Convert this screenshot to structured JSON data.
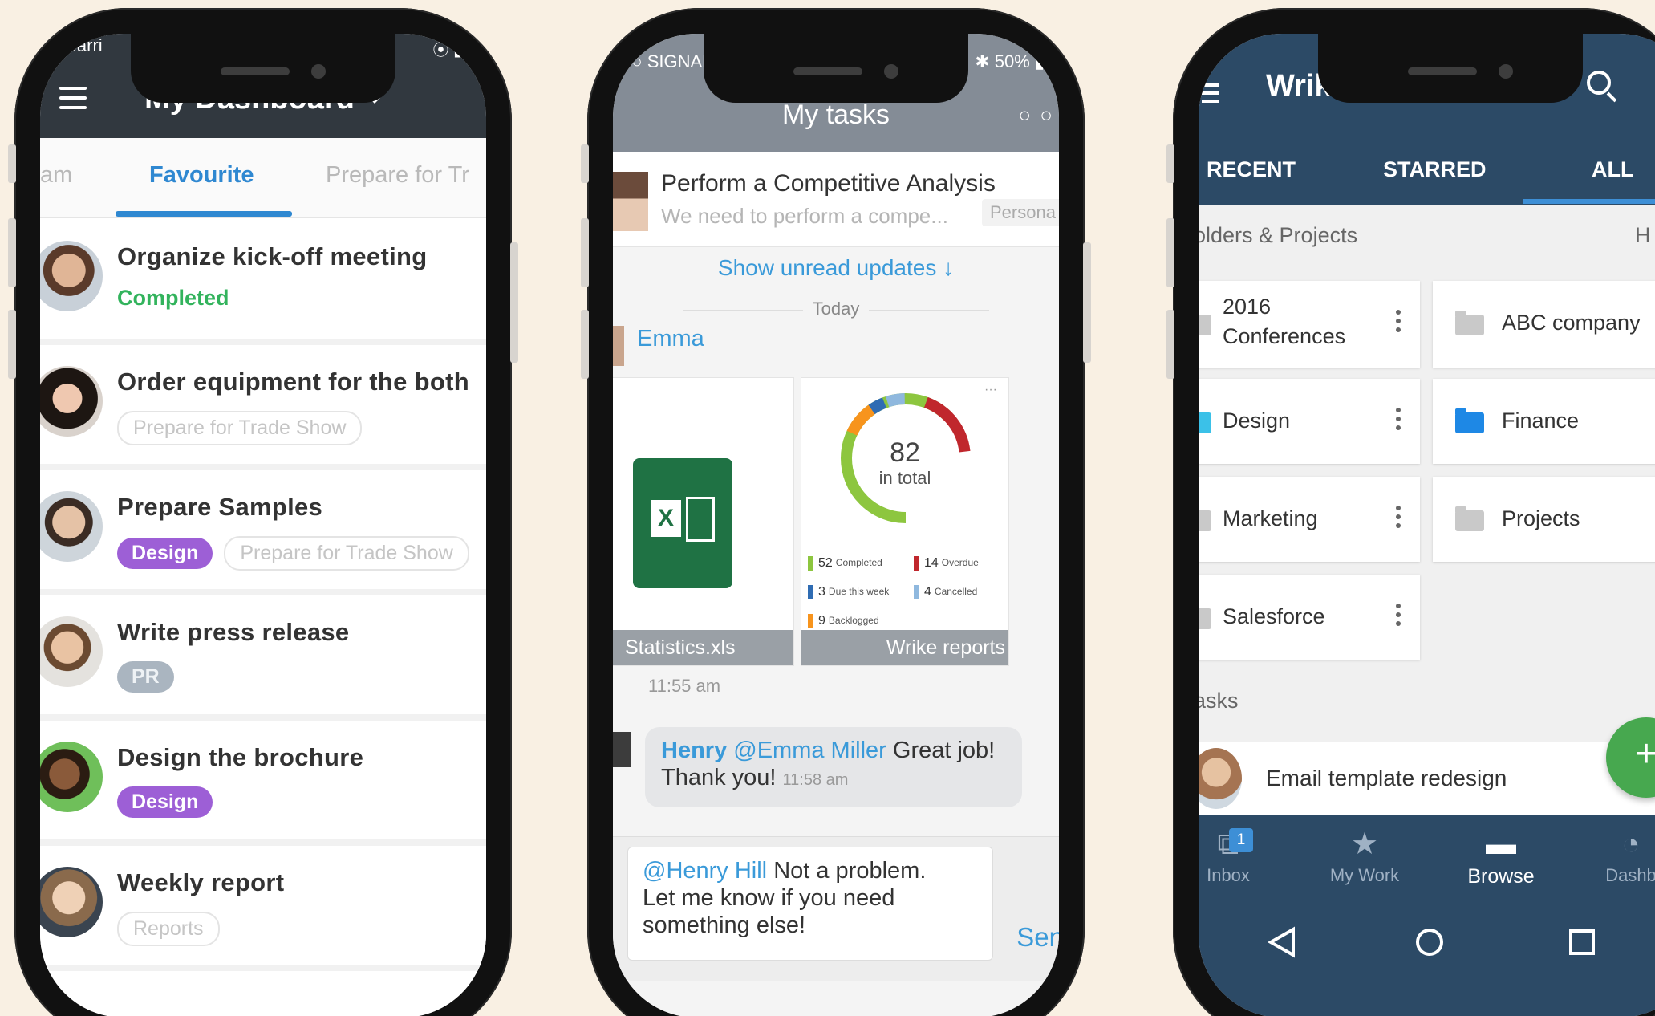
{
  "phone1": {
    "status": {
      "carrier": "Carri",
      "wifi": "⦿ ▮"
    },
    "header": {
      "title": "My Dashboard"
    },
    "tabs": [
      "am",
      "Favourite",
      "Prepare for Tr"
    ],
    "tasks": [
      {
        "title": "Organize kick-off meeting",
        "status": "Completed"
      },
      {
        "title": "Order equipment for the both",
        "tags": [
          "Prepare for Trade Show"
        ]
      },
      {
        "title": "Prepare Samples",
        "tags": [
          "Design",
          "Prepare for Trade Show"
        ]
      },
      {
        "title": "Write press release",
        "tags": [
          "PR"
        ]
      },
      {
        "title": "Design the brochure",
        "tags": [
          "Design"
        ]
      },
      {
        "title": "Weekly report",
        "tags": [
          "Reports"
        ]
      }
    ]
  },
  "phone2": {
    "status": {
      "signal": "●○ SIGNAL",
      "battery": "✱ 50% ▮"
    },
    "header": {
      "title": "My tasks",
      "more": "○ ○"
    },
    "task": {
      "title": "Perform a Competitive Analysis",
      "desc": "We need to perform a compe...",
      "tag": "Persona"
    },
    "unread": "Show unread updates ↓",
    "today": "Today",
    "author": "Emma",
    "attachments": {
      "file": "Statistics.xls",
      "report": "Wrike reports",
      "excel_letter": "X",
      "report_total": "82",
      "report_total_label": "in total",
      "legend": [
        {
          "value": "52",
          "label": "Completed",
          "color": "#8dc63f"
        },
        {
          "value": "14",
          "label": "Overdue",
          "color": "#c0272d"
        },
        {
          "value": "3",
          "label": "Due this week",
          "color": "#2f6cb3"
        },
        {
          "value": "4",
          "label": "Cancelled",
          "color": "#8fb8de"
        },
        {
          "value": "9",
          "label": "Backlogged",
          "color": "#f7941d"
        }
      ],
      "more": "···"
    },
    "time1": "11:55 am",
    "comment": {
      "name": "Henry",
      "mention": "@Emma Miller",
      "text1": "Great job!",
      "text2": "Thank you!",
      "time": "11:58 am"
    },
    "compose": {
      "mention": "@Henry Hill",
      "text1": "Not a problem.",
      "text2": "Let me know if you need",
      "text3": "something else!",
      "send": "Sen"
    }
  },
  "phone3": {
    "header": {
      "title": "Wrike"
    },
    "tabs": [
      "RECENT",
      "STARRED",
      "ALL"
    ],
    "section1": "olders & Projects",
    "section1_right": "H",
    "folders": [
      {
        "line1": "2016",
        "line2": "Conferences"
      },
      {
        "line1": "ABC company"
      },
      {
        "line1": "Design"
      },
      {
        "line1": "Finance"
      },
      {
        "line1": "Marketing"
      },
      {
        "line1": "Projects"
      },
      {
        "line1": "Salesforce"
      }
    ],
    "section2": "asks",
    "task": "Email template redesign",
    "fab": "+",
    "nav": [
      {
        "label": "Inbox",
        "badge": "1"
      },
      {
        "label": "My Work"
      },
      {
        "label": "Browse"
      },
      {
        "label": "Dashb"
      }
    ]
  }
}
